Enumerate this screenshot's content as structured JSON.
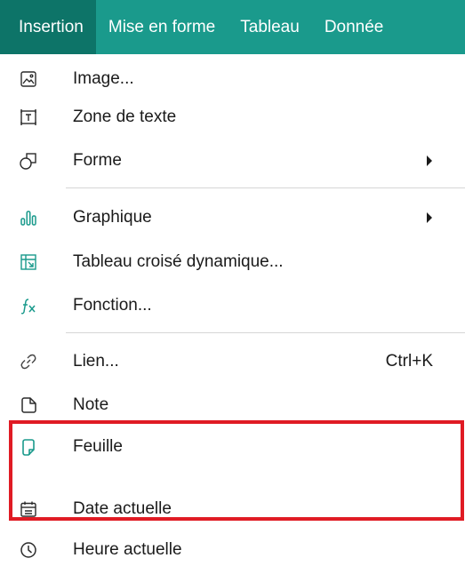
{
  "menubar": {
    "items": [
      {
        "label": "Insertion",
        "active": true
      },
      {
        "label": "Mise en forme"
      },
      {
        "label": "Tableau"
      },
      {
        "label": "Donnée"
      }
    ]
  },
  "menu": {
    "items": [
      {
        "label": "Image...",
        "icon": "image-icon"
      },
      {
        "label": "Zone de texte",
        "icon": "text-box-icon"
      },
      {
        "label": "Forme",
        "icon": "shape-icon",
        "submenu": true
      },
      {
        "label": "Graphique",
        "icon": "chart-icon",
        "submenu": true
      },
      {
        "label": "Tableau croisé dynamique...",
        "icon": "pivot-table-icon"
      },
      {
        "label": "Fonction...",
        "icon": "function-icon"
      },
      {
        "label": "Lien...",
        "icon": "link-icon",
        "shortcut": "Ctrl+K"
      },
      {
        "label": "Note",
        "icon": "note-icon"
      },
      {
        "label": "Feuille",
        "icon": "sheet-icon"
      },
      {
        "label": "Date actuelle",
        "icon": "calendar-icon"
      },
      {
        "label": "Heure actuelle",
        "icon": "clock-icon"
      }
    ]
  },
  "colors": {
    "menubar_bg": "#1a9a8c",
    "menubar_active_bg": "#0d7468",
    "highlight_border": "#e01b24"
  }
}
